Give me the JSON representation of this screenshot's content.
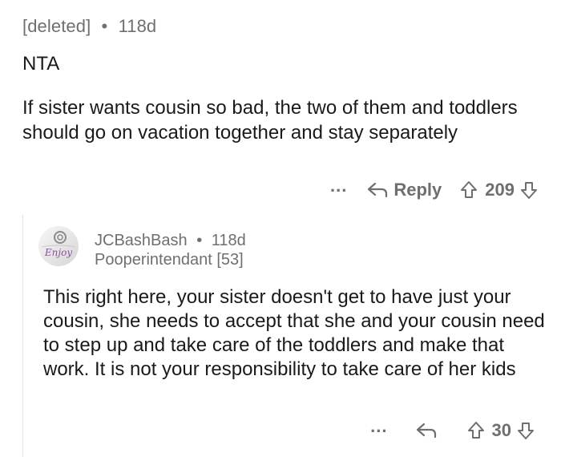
{
  "top_comment": {
    "author": "[deleted]",
    "separator": "•",
    "age": "118d",
    "body": [
      "NTA",
      "If sister wants cousin so bad, the two of them and toddlers should go on vacation together and stay separately"
    ],
    "actions": {
      "more_label": "...",
      "reply_label": "Reply",
      "score": "209"
    }
  },
  "reply_comment": {
    "avatar_text": "Enjoy",
    "author": "JCBashBash",
    "separator": "•",
    "age": "118d",
    "flair": "Pooperintendant [53]",
    "body": "This right here, your sister doesn't get to have just your cousin, she needs to accept that she and your cousin need to step up and take care of the toddlers and make that work. It is not your responsibility to take care of her kids",
    "actions": {
      "more_label": "...",
      "score": "30"
    }
  },
  "icons": {
    "more": "more-options-icon",
    "reply": "reply-arrow-icon",
    "upvote": "upvote-arrow-icon",
    "downvote": "downvote-arrow-icon"
  },
  "colors": {
    "text_primary": "#1a1a1b",
    "text_secondary": "#6f6f6f",
    "thread_line": "#e2e2e2"
  }
}
